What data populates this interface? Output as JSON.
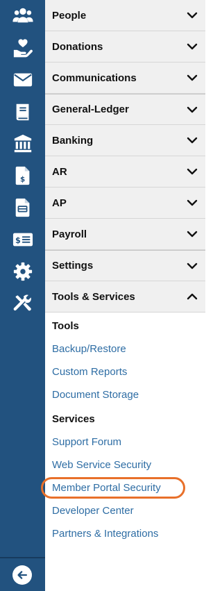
{
  "rail": {
    "icons": [
      "people-icon",
      "donation-hand-heart-icon",
      "envelope-icon",
      "ledger-book-icon",
      "bank-icon",
      "invoice-dollar-icon",
      "bill-document-icon",
      "payroll-money-card-icon",
      "gear-icon",
      "tools-icon"
    ],
    "bottom_icon": "back-arrow-icon"
  },
  "menu": {
    "items": [
      {
        "label": "People",
        "expanded": false
      },
      {
        "label": "Donations",
        "expanded": false
      },
      {
        "label": "Communications",
        "expanded": false
      },
      {
        "label": "General-Ledger",
        "expanded": false
      },
      {
        "label": "Banking",
        "expanded": false
      },
      {
        "label": "AR",
        "expanded": false
      },
      {
        "label": "AP",
        "expanded": false
      },
      {
        "label": "Payroll",
        "expanded": false
      },
      {
        "label": "Settings",
        "expanded": false
      },
      {
        "label": "Tools & Services",
        "expanded": true
      }
    ]
  },
  "submenu": {
    "tools_heading": "Tools",
    "tools_links": [
      "Backup/Restore",
      "Custom Reports",
      "Document Storage"
    ],
    "services_heading": "Services",
    "services_links": [
      "Support Forum",
      "Web Service Security",
      "Member Portal Security",
      "Developer Center",
      "Partners & Integrations"
    ],
    "highlighted": "Member Portal Security"
  },
  "colors": {
    "rail": "#22527f",
    "link": "#2e6da4",
    "highlight": "#e8702a"
  }
}
